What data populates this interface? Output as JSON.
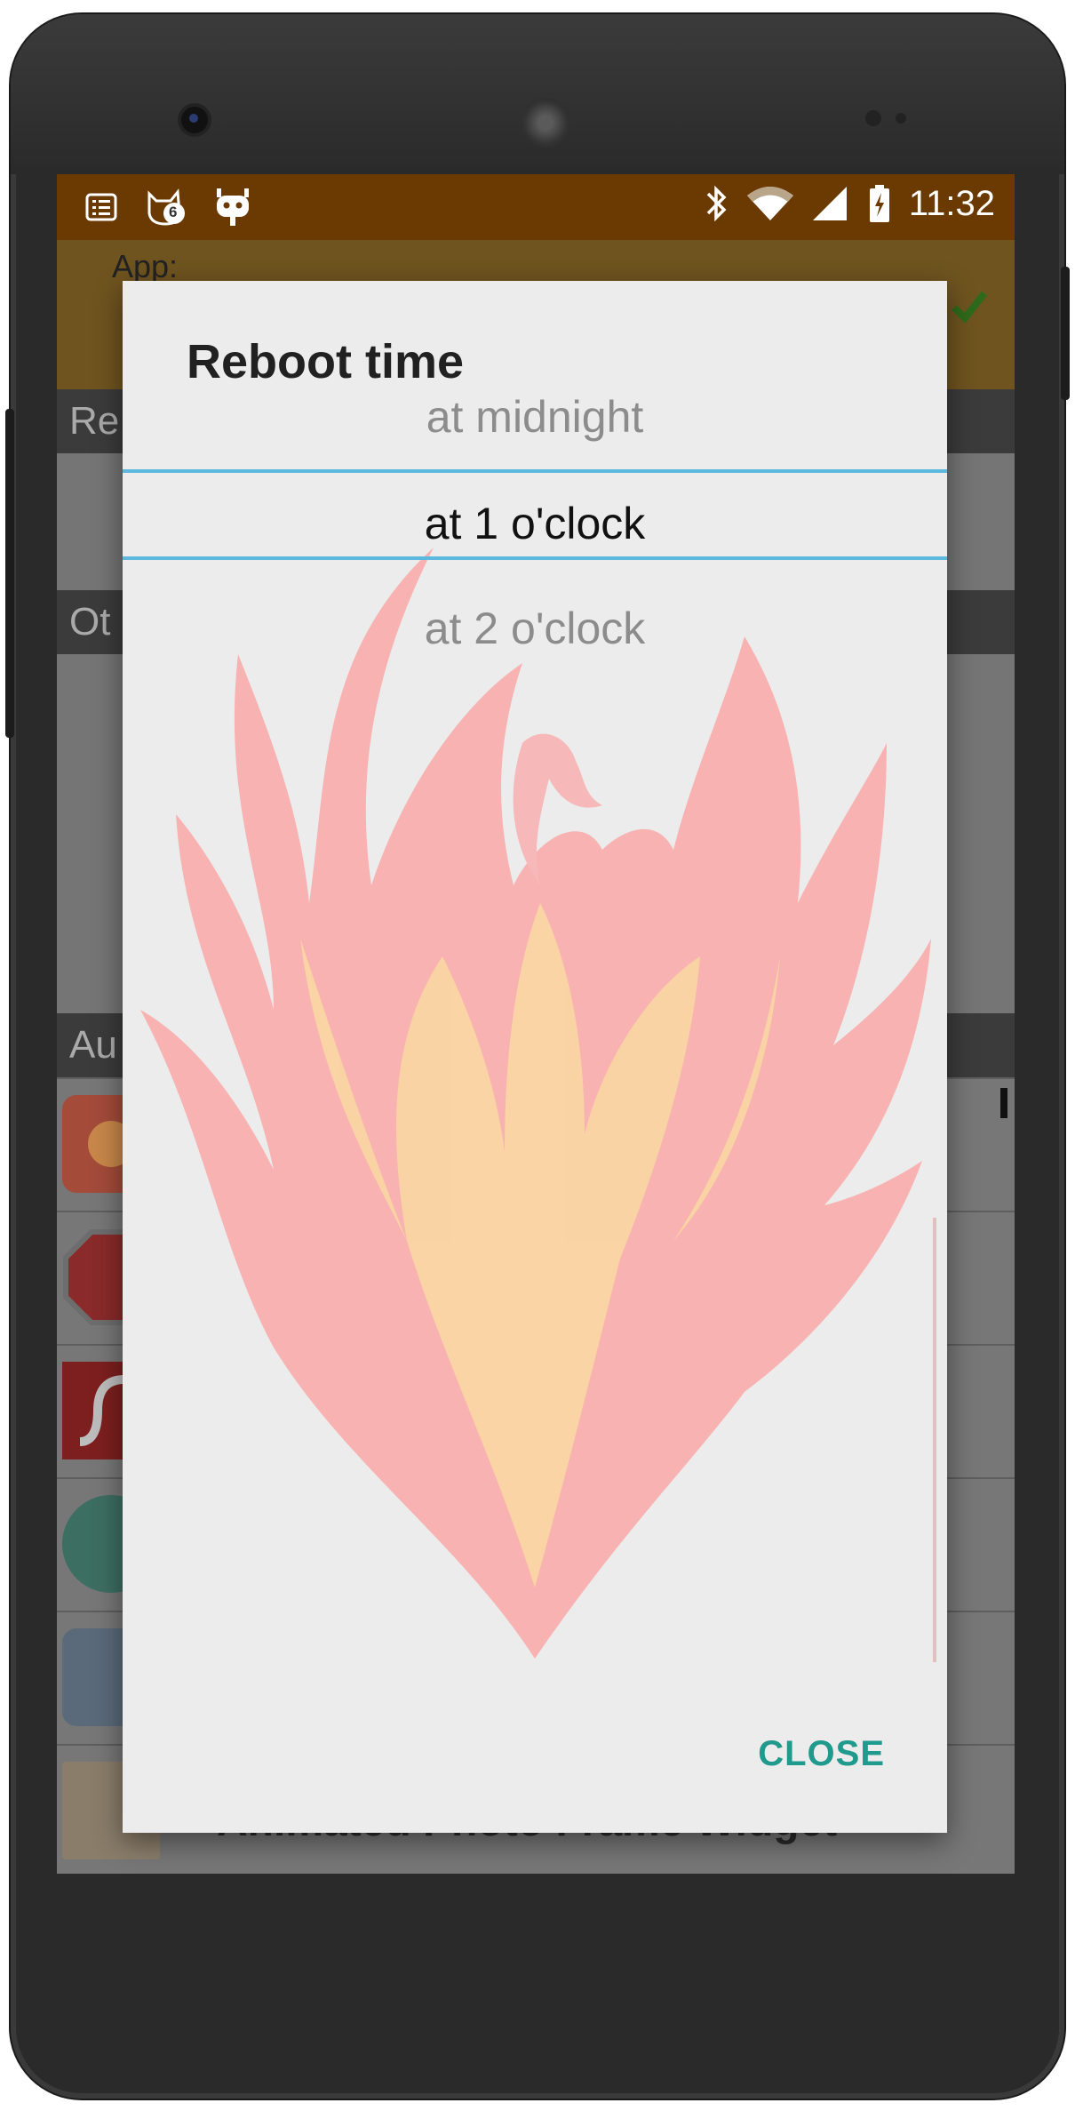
{
  "status_bar": {
    "time": "11:32",
    "notification_badge": "6",
    "left_icons": [
      "task-list-icon",
      "cat-notification-icon",
      "cyanogen-mod-icon"
    ],
    "right_icons": [
      "bluetooth-icon",
      "wifi-icon",
      "cell-signal-icon",
      "battery-charging-icon"
    ]
  },
  "background_app": {
    "app_label": "App:",
    "sections": [
      {
        "label": "Re"
      },
      {
        "label": "Ot"
      },
      {
        "label": "Au"
      }
    ],
    "list_rows": [
      {
        "icon": "sun-app-icon"
      },
      {
        "icon": "stop-sign-app-icon"
      },
      {
        "icon": "flash-app-icon"
      },
      {
        "icon": "mustache-app-icon"
      },
      {
        "icon": "toolbox-app-icon"
      },
      {
        "icon": "photo-frame-app-icon",
        "text": "Animated Photo Frame Widget"
      }
    ]
  },
  "dialog": {
    "title": "Reboot time",
    "picker": {
      "previous": "at midnight",
      "selected": "at 1 o'clock",
      "next": "at 2 o'clock"
    },
    "close_label": "CLOSE"
  },
  "colors": {
    "status_bar": "#6b3a02",
    "dialog_bg": "#ececec",
    "picker_divider": "#5db8de",
    "close_accent": "#1f9a8c"
  }
}
